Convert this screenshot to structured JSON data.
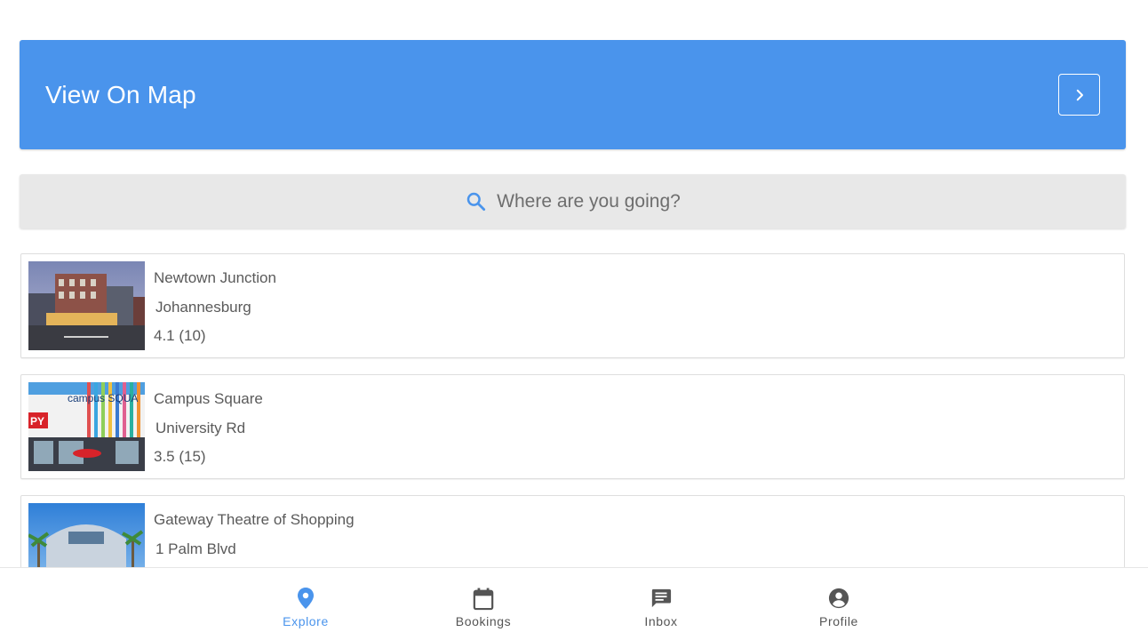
{
  "map_banner": {
    "title": "View On Map",
    "arrow_icon": "chevron-right-icon"
  },
  "search": {
    "placeholder": "Where are you going?",
    "icon": "search-icon"
  },
  "places": [
    {
      "name": "Newtown Junction",
      "address": "Johannesburg",
      "rating": "4.1 (10)",
      "image": "newtown-junction-photo"
    },
    {
      "name": "Campus Square",
      "address": "University Rd",
      "rating": "3.5 (15)",
      "image": "campus-square-photo",
      "image_sign": "campus SQUA",
      "image_sign2": "PY"
    },
    {
      "name": "Gateway Theatre of Shopping",
      "address": "1 Palm Blvd",
      "rating": "",
      "image": "gateway-theatre-photo"
    }
  ],
  "bottom_nav": {
    "active": "Explore",
    "items": [
      {
        "label": "Explore",
        "icon": "location-pin-icon"
      },
      {
        "label": "Bookings",
        "icon": "calendar-icon"
      },
      {
        "label": "Inbox",
        "icon": "chat-icon"
      },
      {
        "label": "Profile",
        "icon": "account-circle-icon"
      }
    ]
  },
  "colors": {
    "primary": "#4a94ec",
    "search_bg": "#e8e8e8",
    "text": "#5a5a5a",
    "inactive_icon": "#555555"
  }
}
